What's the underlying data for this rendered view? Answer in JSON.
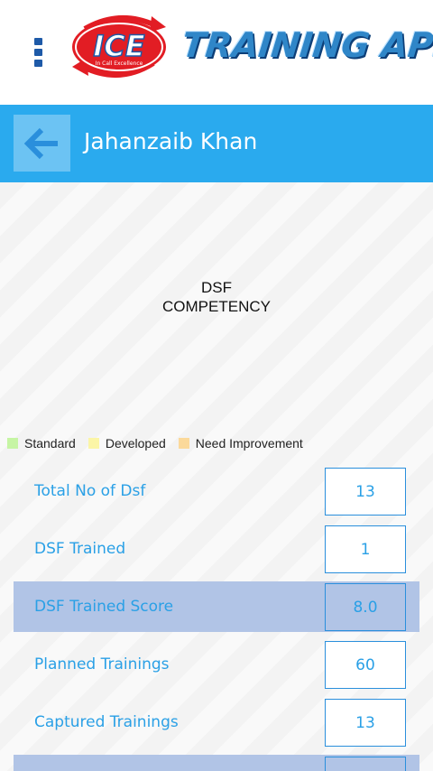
{
  "app": {
    "logo_text": "ICE",
    "logo_subtext": "In Call Excellence",
    "title": "TRAINING APP"
  },
  "header": {
    "title": "Jahanzaib Khan"
  },
  "chart": {
    "line1": "DSF",
    "line2": "COMPETENCY"
  },
  "legend": [
    {
      "label": "Standard",
      "color": "#c6f5a4"
    },
    {
      "label": "Developed",
      "color": "#fbf5a6"
    },
    {
      "label": "Need Improvement",
      "color": "#fbd99a"
    }
  ],
  "stats": [
    {
      "label": "Total No of Dsf",
      "value": "13"
    },
    {
      "label": "DSF Trained",
      "value": "1"
    },
    {
      "label": "DSF Trained Score",
      "value": "8.0"
    },
    {
      "label": "Planned Trainings",
      "value": "60"
    },
    {
      "label": "Captured Trainings",
      "value": "13"
    }
  ],
  "colors": {
    "accent": "#2aaaee",
    "highlight": "#b1c4e6",
    "text_blue": "#2aa0e6"
  }
}
